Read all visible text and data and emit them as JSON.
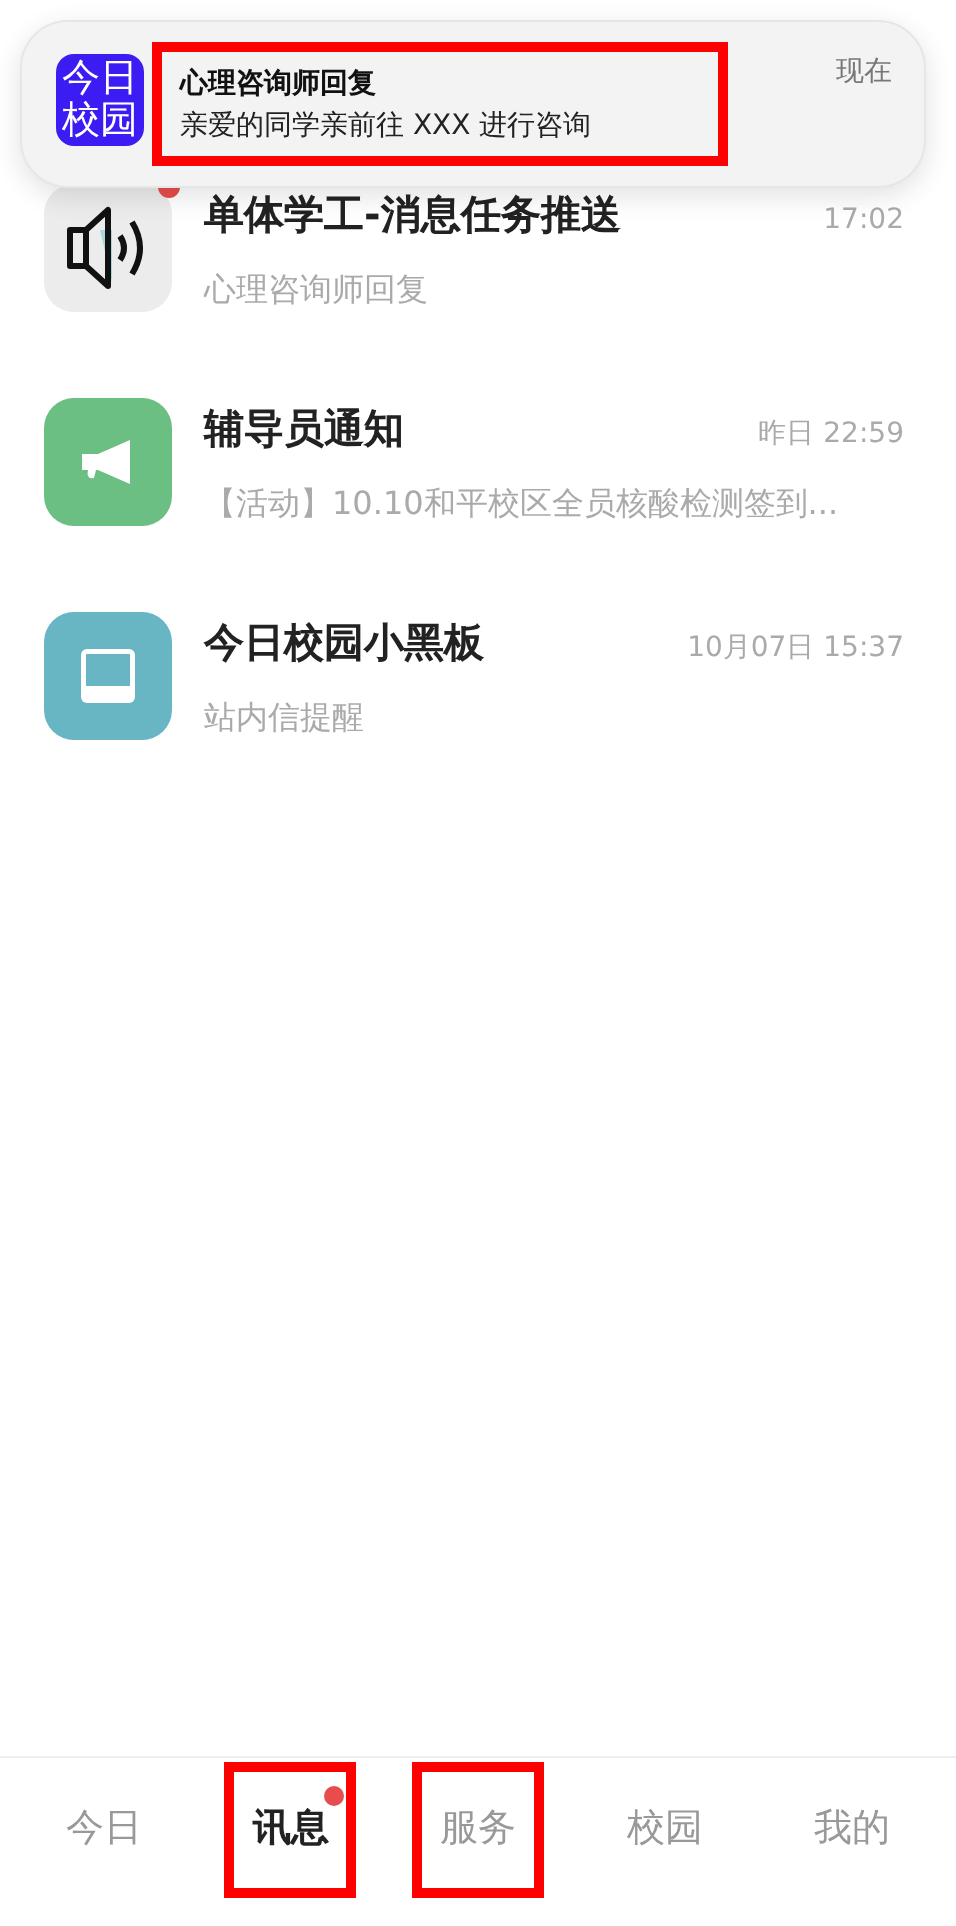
{
  "notification": {
    "app_logo": "今日校园",
    "title": "心理咨询师回复",
    "body": "亲爱的同学亲前往 XXX 进行咨询",
    "time": "现在",
    "highlighted": true
  },
  "conversations": [
    {
      "title": "单体学工-消息任务推送",
      "time": "17:02",
      "preview": "心理咨询师回复",
      "unread": true,
      "color": "#ececec"
    },
    {
      "title": "辅导员通知",
      "time": "昨日 22:59",
      "preview": "【活动】10.10和平校区全员核酸检测签到...",
      "unread": false,
      "color": "#6cbf82"
    },
    {
      "title": "今日校园小黑板",
      "time": "10月07日 15:37",
      "preview": "站内信提醒",
      "unread": false,
      "color": "#68b5c4"
    }
  ],
  "tabs": [
    {
      "label": "今日",
      "selected": false,
      "unread": false,
      "highlighted": false
    },
    {
      "label": "讯息",
      "selected": true,
      "unread": true,
      "highlighted": true
    },
    {
      "label": "服务",
      "selected": false,
      "unread": false,
      "highlighted": true
    },
    {
      "label": "校园",
      "selected": false,
      "unread": false,
      "highlighted": false
    },
    {
      "label": "我的",
      "selected": false,
      "unread": false,
      "highlighted": false
    }
  ]
}
